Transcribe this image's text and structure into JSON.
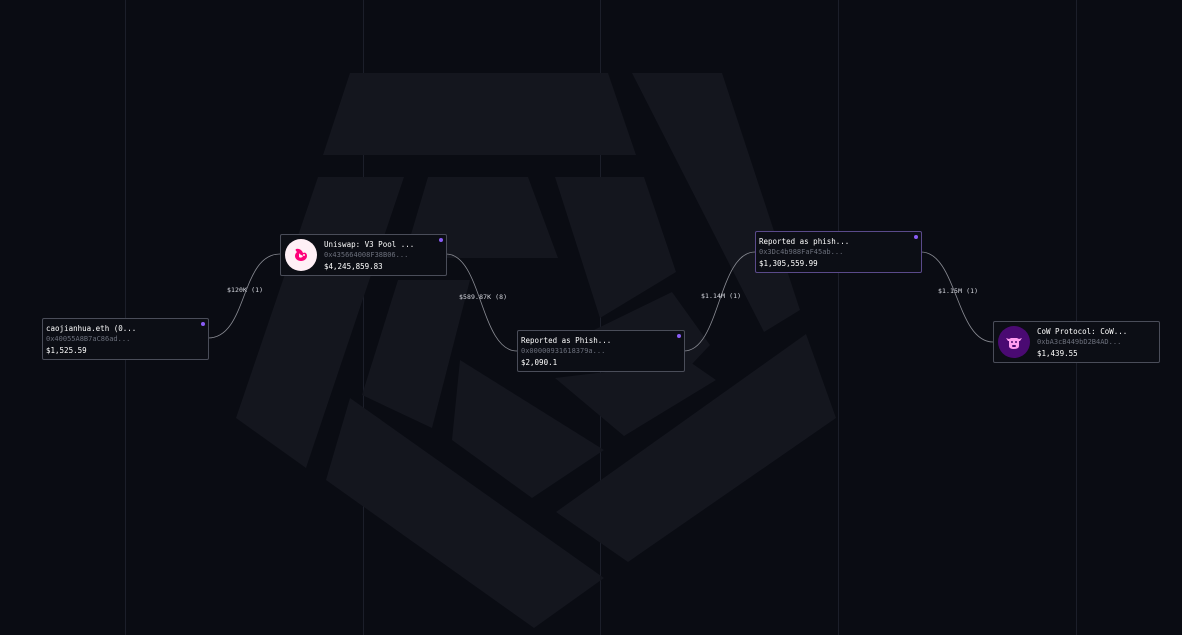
{
  "graph": {
    "nodes": [
      {
        "name": "caojianhua.eth (0...",
        "address": "0x40055A8B7aC86ad...",
        "balance": "$1,525.59",
        "icon": "none"
      },
      {
        "name": "Uniswap: V3 Pool ...",
        "address": "0x435664008F38B06...",
        "balance": "$4,245,859.83",
        "icon": "uniswap-logo-icon"
      },
      {
        "name": "Reported as Phish...",
        "address": "0x00000931618379a...",
        "balance": "$2,090.1",
        "icon": "none"
      },
      {
        "name": "Reported as phish...",
        "address": "0x3Dc4b988FaF45ab...",
        "balance": "$1,305,559.99",
        "icon": "none"
      },
      {
        "name": "CoW Protocol: CoW...",
        "address": "0xbA3cB449bD2B4AD...",
        "balance": "$1,439.55",
        "icon": "cow-protocol-logo-icon"
      }
    ],
    "edges": [
      {
        "label": "$120K (1)"
      },
      {
        "label": "$589.87K (8)"
      },
      {
        "label": "$1.14M (1)"
      },
      {
        "label": "$1.15M (1)"
      }
    ]
  },
  "colors": {
    "background": "#0a0c13",
    "node_border": "#4a4d59",
    "node_dot": "#8a5cf5",
    "watermark": "#15171f"
  }
}
